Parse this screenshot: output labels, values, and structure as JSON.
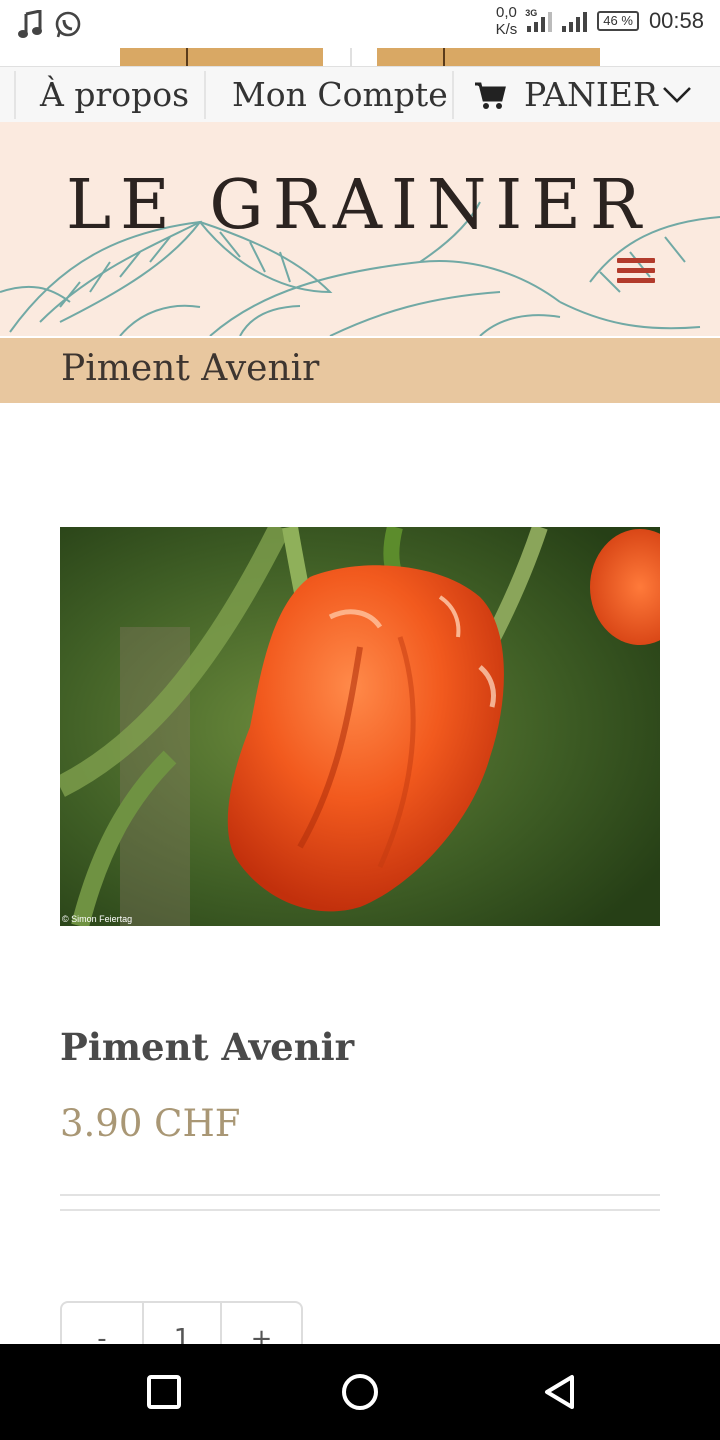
{
  "status_bar": {
    "net_speed_value": "0,0",
    "net_speed_unit": "K/s",
    "network_type": "3G",
    "battery": "46 %",
    "time": "00:58",
    "icons": [
      "music-note-icon",
      "whatsapp-icon",
      "signal-icon",
      "battery-icon"
    ]
  },
  "nav": {
    "about": "À propos",
    "account": "Mon Compte",
    "cart": "PANIER",
    "icons": [
      "cart-icon",
      "chevron-down-icon"
    ]
  },
  "header": {
    "brand": "LE GRAINIER",
    "menu_icon": "hamburger-menu-icon"
  },
  "page": {
    "title": "Piment Avenir"
  },
  "product": {
    "image_credit": "© Simon Feiertag",
    "title": "Piment Avenir",
    "price": "3.90 CHF"
  },
  "quantity": {
    "minus": "-",
    "value": "1",
    "plus": "+"
  },
  "colors": {
    "header_bg": "#fbeadf",
    "title_band": "#e8c79f",
    "hamburger": "#b23b2c",
    "price": "#a99775"
  },
  "android_nav": [
    "recent-apps-icon",
    "home-icon",
    "back-icon"
  ]
}
